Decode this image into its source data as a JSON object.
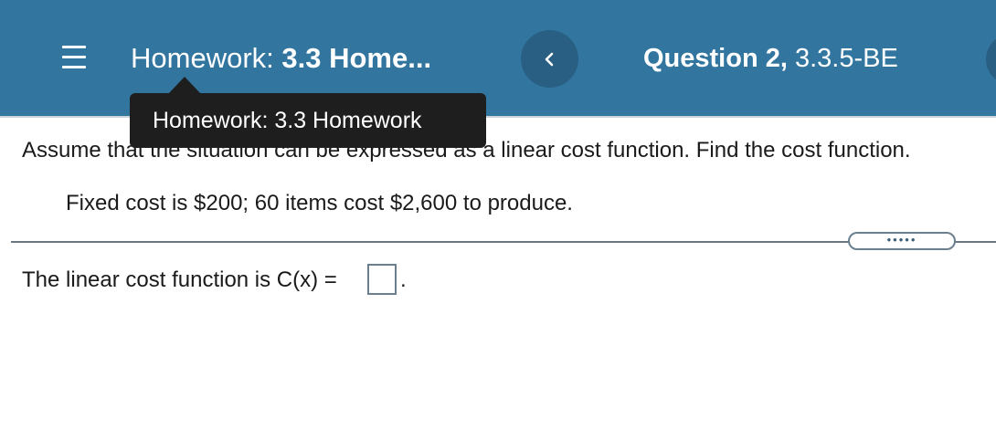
{
  "header": {
    "homework_prefix": "Homework:",
    "homework_name_truncated": "3.3 Home...",
    "question_prefix": "Question 2,",
    "question_code": "3.3.5-BE",
    "menu_icon": "hamburger-menu-icon",
    "back_icon": "chevron-left-icon"
  },
  "tooltip": {
    "text": "Homework: 3.3 Homework"
  },
  "question": {
    "prompt": "Assume that the situation can be expressed as a linear cost function. Find the cost function.",
    "given": "Fixed cost is $200; 60 items cost $2,600 to produce.",
    "more_label": "•••••",
    "answer_label": "The linear cost function is C(x) =",
    "answer_value": "",
    "answer_suffix": "."
  },
  "colors": {
    "header_bg": "#3276a0",
    "button_bg": "#285f83",
    "tooltip_bg": "#1e1e1e"
  }
}
